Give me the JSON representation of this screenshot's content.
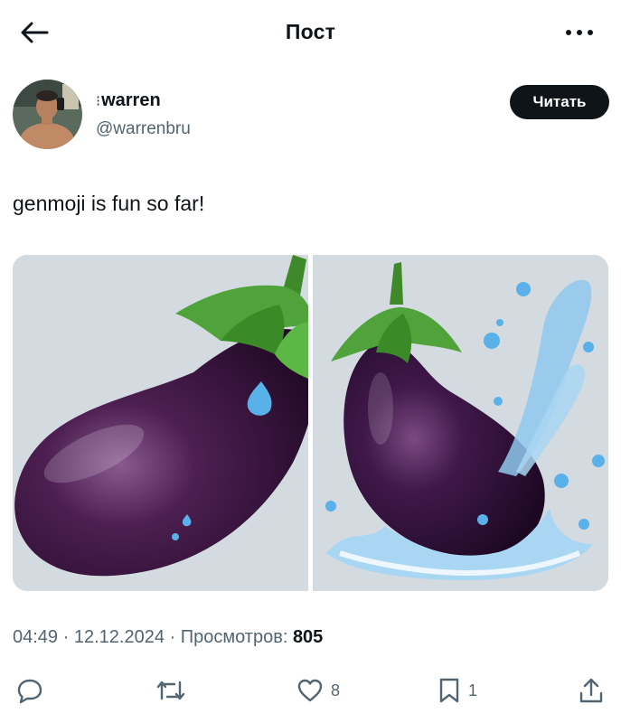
{
  "header": {
    "title": "Пост",
    "back_icon": "arrow-left-icon",
    "more_icon": "more-horizontal-icon"
  },
  "author": {
    "display_name": "warren",
    "name_prefix": "⁝",
    "handle": "@warrenbru",
    "follow_label": "Читать"
  },
  "post": {
    "text": "genmoji is fun so far!",
    "images": [
      {
        "alt": "eggplant-with-droplets"
      },
      {
        "alt": "eggplant-with-splash"
      }
    ]
  },
  "meta": {
    "time": "04:49",
    "sep1": " · ",
    "date": "12.12.2024",
    "sep2": " · ",
    "views_label": "Просмотров: ",
    "views_count": "805"
  },
  "actions": {
    "reply_count": "",
    "repost_count": "",
    "like_count": "8",
    "bookmark_count": "1"
  },
  "colors": {
    "text": "#0f1419",
    "secondary": "#536471",
    "button_bg": "#0f1419",
    "media_bg": "#d2d9de"
  }
}
